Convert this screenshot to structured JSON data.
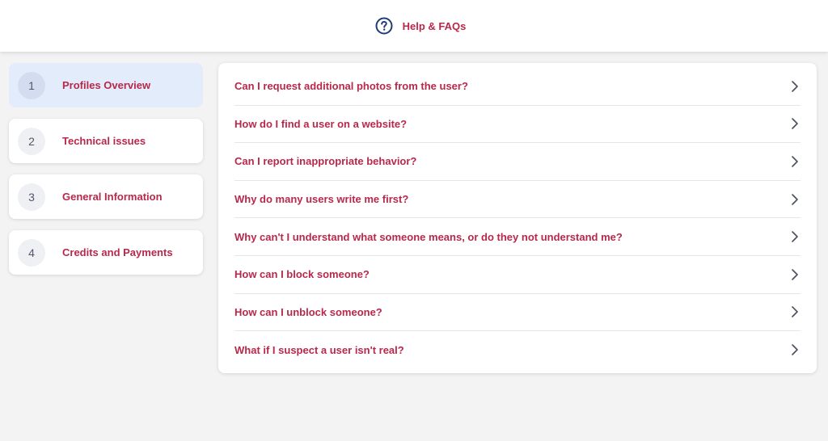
{
  "header": {
    "title": "Help & FAQs",
    "icon": "help-circle-icon",
    "accent": "#b8284a",
    "icon_color": "#1f3c7a"
  },
  "sidebar": {
    "items": [
      {
        "number": "1",
        "label": "Profiles Overview",
        "active": true
      },
      {
        "number": "2",
        "label": "Technical issues",
        "active": false
      },
      {
        "number": "3",
        "label": "General Information",
        "active": false
      },
      {
        "number": "4",
        "label": "Credits and Payments",
        "active": false
      }
    ]
  },
  "faq": {
    "questions": [
      "Can I request additional photos from the user?",
      "How do I find a user on a website?",
      "Can I report inappropriate behavior?",
      "Why do many users write me first?",
      "Why can't I understand what someone means, or do they not understand me?",
      "How can I block someone?",
      "How can I unblock someone?",
      "What if I suspect a user isn't real?"
    ],
    "row_icon": "chevron-right-icon"
  }
}
